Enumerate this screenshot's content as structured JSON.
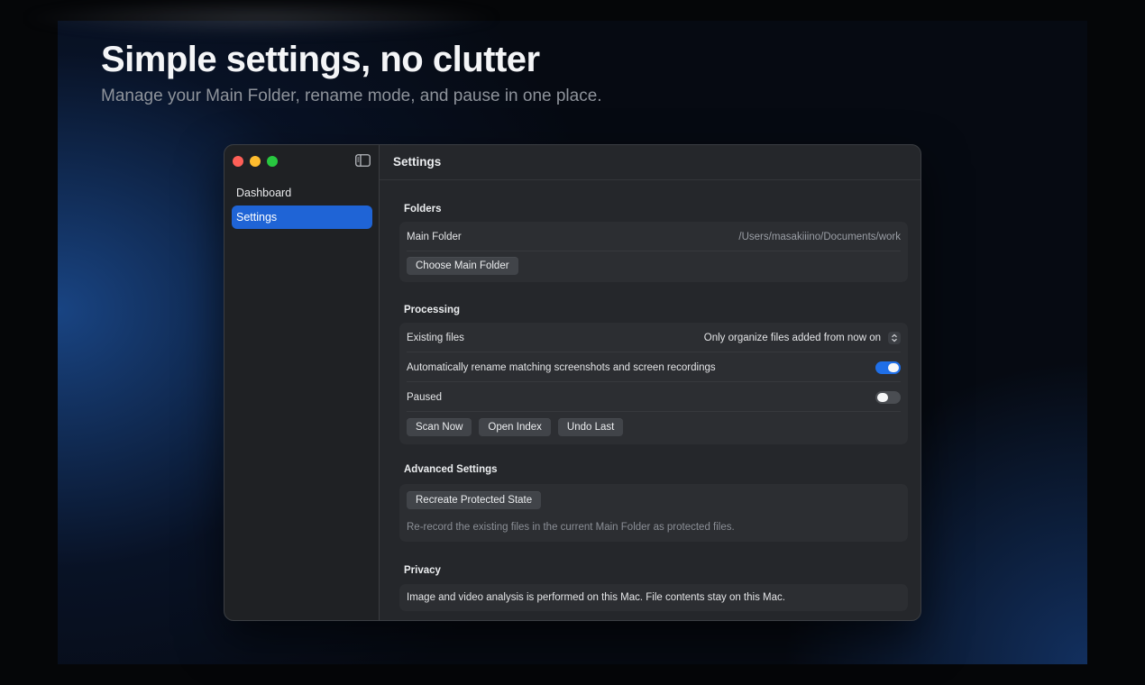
{
  "hero": {
    "title": "Simple settings, no clutter",
    "subtitle": "Manage your Main Folder, rename mode, and pause in one place."
  },
  "window": {
    "controls": [
      "close",
      "minimize",
      "zoom"
    ],
    "sidebar_toggle_icon": "sidebar-left-icon"
  },
  "sidebar": {
    "items": [
      {
        "label": "Dashboard",
        "active": false
      },
      {
        "label": "Settings",
        "active": true
      }
    ]
  },
  "header": {
    "title": "Settings"
  },
  "sections": {
    "folders": {
      "title": "Folders",
      "main_folder_label": "Main Folder",
      "main_folder_path": "/Users/masakiiino/Documents/work",
      "choose_button": "Choose Main Folder"
    },
    "processing": {
      "title": "Processing",
      "existing_files_label": "Existing files",
      "existing_files_value": "Only organize files added from now on",
      "auto_rename_label": "Automatically rename matching screenshots and screen recordings",
      "auto_rename_on": true,
      "paused_label": "Paused",
      "paused_on": false,
      "buttons": [
        "Scan Now",
        "Open Index",
        "Undo Last"
      ]
    },
    "advanced": {
      "title": "Advanced Settings",
      "recreate_button": "Recreate Protected State",
      "note": "Re-record the existing files in the current Main Folder as protected files."
    },
    "privacy": {
      "title": "Privacy",
      "note": "Image and video analysis is performed on this Mac. File contents stay on this Mac."
    }
  },
  "colors": {
    "accent": "#1f64d6",
    "toggle_on": "#1f6fe8",
    "window_bg": "#25272b",
    "sidebar_bg": "#1f2124"
  }
}
